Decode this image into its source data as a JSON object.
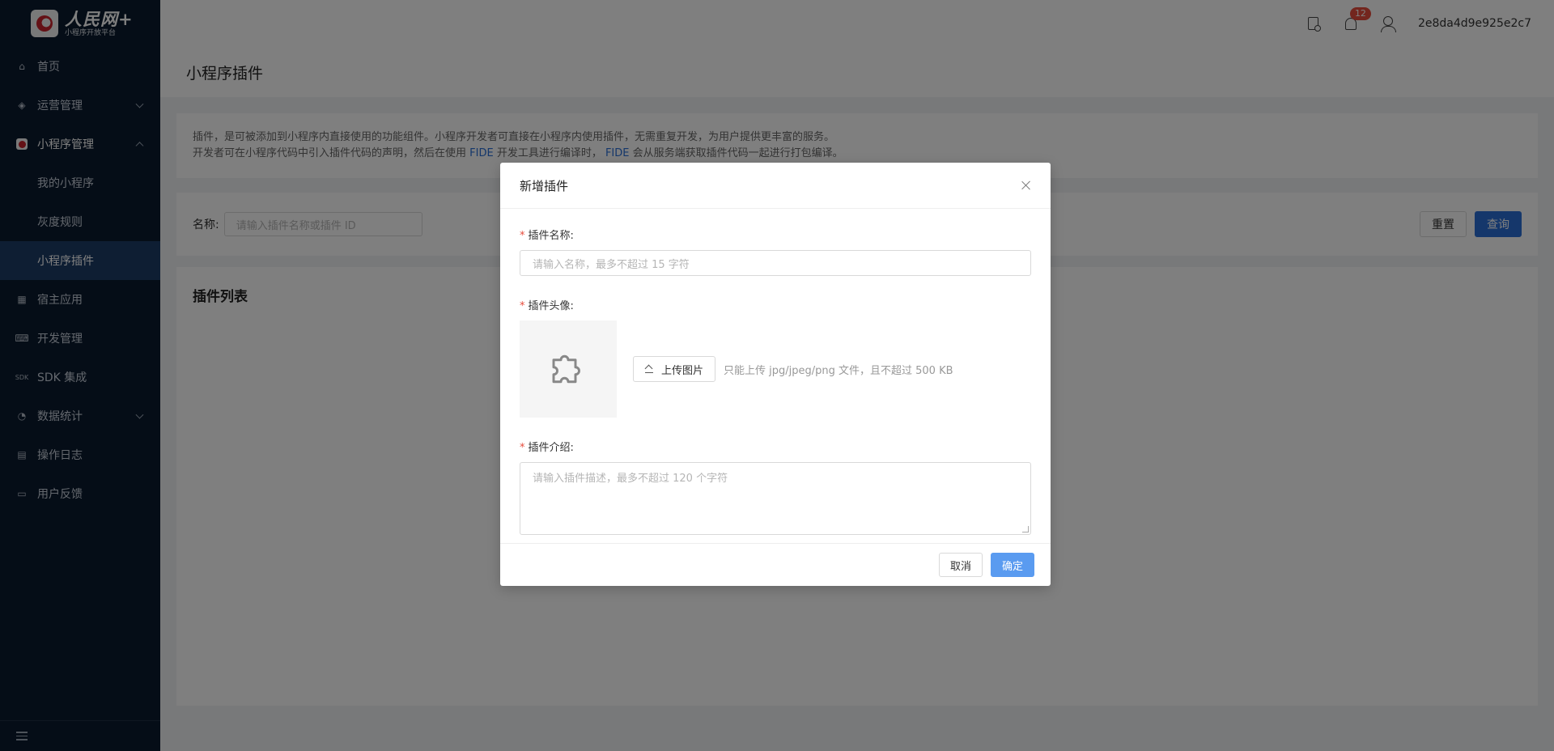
{
  "logo": {
    "main": "人民网+",
    "sub": "小程序开放平台"
  },
  "sidebar": {
    "items": [
      {
        "label": "首页"
      },
      {
        "label": "运营管理"
      },
      {
        "label": "小程序管理"
      },
      {
        "label": "我的小程序"
      },
      {
        "label": "灰度规则"
      },
      {
        "label": "小程序插件"
      },
      {
        "label": "宿主应用"
      },
      {
        "label": "开发管理"
      },
      {
        "label": "SDK 集成"
      },
      {
        "label": "数据统计"
      },
      {
        "label": "操作日志"
      },
      {
        "label": "用户反馈"
      }
    ]
  },
  "header": {
    "notification_count": "12",
    "username": "2e8da4d9e925e2c7"
  },
  "page": {
    "title": "小程序插件",
    "intro_line1": "插件，是可被添加到小程序内直接使用的功能组件。小程序开发者可直接在小程序内使用插件，无需重复开发，为用户提供更丰富的服务。",
    "intro_line2_a": "开发者可在小程序代码中引入插件代码的声明，然后在使用 ",
    "intro_link1": "FIDE",
    "intro_line2_b": " 开发工具进行编译时， ",
    "intro_link2": "FIDE",
    "intro_line2_c": " 会从服务端获取插件代码一起进行打包编译。",
    "filter_label": "名称:",
    "filter_placeholder": "请输入插件名称或插件 ID",
    "reset_label": "重置",
    "query_label": "查询",
    "list_title": "插件列表"
  },
  "modal": {
    "title": "新增插件",
    "name_label": "插件名称:",
    "name_placeholder": "请输入名称，最多不超过 15 字符",
    "avatar_label": "插件头像:",
    "upload_label": "上传图片",
    "upload_hint": "只能上传 jpg/jpeg/png 文件，且不超过 500 KB",
    "intro_label": "插件介绍:",
    "intro_placeholder": "请输入插件描述，最多不超过 120 个字符",
    "cancel_label": "取消",
    "confirm_label": "确定"
  }
}
